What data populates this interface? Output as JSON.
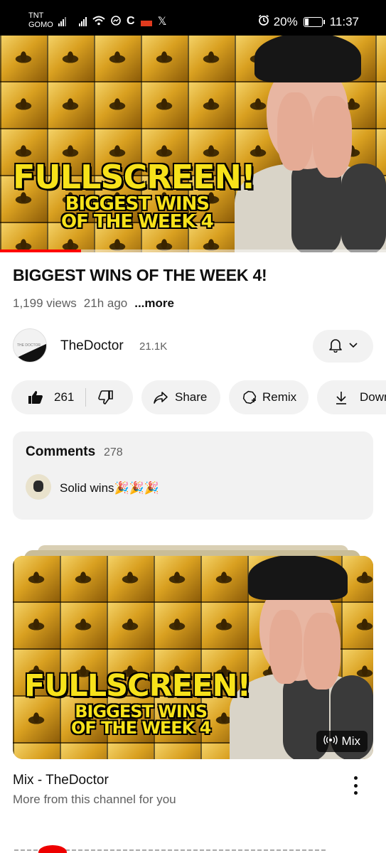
{
  "status_bar": {
    "carrier_line1": "TNT",
    "carrier_line2": "GOMO",
    "battery": "20%",
    "time": "11:37",
    "battery_level": 0.2
  },
  "video": {
    "thumbnail_headline": "FULLSCREEN!",
    "thumbnail_sub1": "BIGGEST WINS",
    "thumbnail_sub2": "OF THE WEEK 4",
    "progress_fraction": 0.21,
    "title": "BIGGEST WINS OF THE WEEK 4!",
    "views": "1,199 views",
    "age": "21h ago",
    "more_label": "...more"
  },
  "channel": {
    "avatar_text": "THE DOCTOR",
    "name": "TheDoctor",
    "subscribers": "21.1K"
  },
  "actions": {
    "likes": "261",
    "share_label": "Share",
    "remix_label": "Remix",
    "download_label": "Down"
  },
  "comments": {
    "header": "Comments",
    "count": "278",
    "top_comment": "Solid wins🎉🎉🎉"
  },
  "mix": {
    "badge_label": "Mix",
    "title": "Mix - TheDoctor",
    "subtitle": "More from this channel for you"
  },
  "colors": {
    "accent_red": "#ff0000",
    "chip_bg": "#f2f2f2",
    "thumbnail_text": "#f7e21a"
  }
}
